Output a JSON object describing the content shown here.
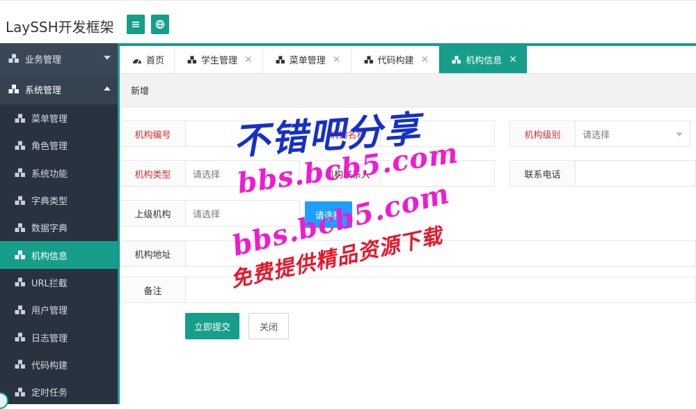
{
  "app": {
    "title": "LaySSH开发框架"
  },
  "header": {
    "menu_icon": "hamburger-icon",
    "globe_icon": "globe-icon"
  },
  "sidebar": {
    "groups": [
      {
        "label": "业务管理",
        "state": "collapsed"
      },
      {
        "label": "系统管理",
        "state": "expanded"
      }
    ],
    "items": [
      {
        "label": "菜单管理"
      },
      {
        "label": "角色管理"
      },
      {
        "label": "系统功能"
      },
      {
        "label": "字典类型"
      },
      {
        "label": "数据字典"
      },
      {
        "label": "机构信息",
        "active": true
      },
      {
        "label": "URL拦截"
      },
      {
        "label": "用户管理"
      },
      {
        "label": "日志管理"
      },
      {
        "label": "代码构建"
      },
      {
        "label": "定时任务"
      }
    ]
  },
  "tabs": [
    {
      "label": "首页",
      "closable": false
    },
    {
      "label": "学生管理",
      "closable": true
    },
    {
      "label": "菜单管理",
      "closable": true
    },
    {
      "label": "代码构建",
      "closable": true
    },
    {
      "label": "机构信息",
      "closable": true,
      "active": true
    }
  ],
  "toolbar": {
    "title": "新增"
  },
  "form": {
    "org_code": {
      "label": "机构编号",
      "value": ""
    },
    "org_name": {
      "label": "机构名称",
      "value": ""
    },
    "org_level": {
      "label": "机构级别",
      "placeholder": "请选择"
    },
    "org_type": {
      "label": "机构类型",
      "placeholder": "请选择"
    },
    "contact": {
      "label": "机构联系人",
      "value": ""
    },
    "phone": {
      "label": "联系电话",
      "value": ""
    },
    "parent": {
      "label": "上级机构",
      "placeholder": "请选择"
    },
    "choose_button": "请选择",
    "address": {
      "label": "机构地址",
      "value": ""
    },
    "remark": {
      "label": "备注",
      "value": ""
    },
    "submit_button": "立即提交",
    "close_button": "关闭"
  },
  "watermark": {
    "line1": "不错吧分享",
    "line2": "bbs.bcb5.com",
    "line3": "bbs.bcb5.com",
    "line4": "免费提供精品资源下载"
  },
  "colors": {
    "accent": "#169e8a",
    "sidebar_bg": "#2f3d4c",
    "required": "#d0302e",
    "blue_button": "#1e9fff"
  }
}
